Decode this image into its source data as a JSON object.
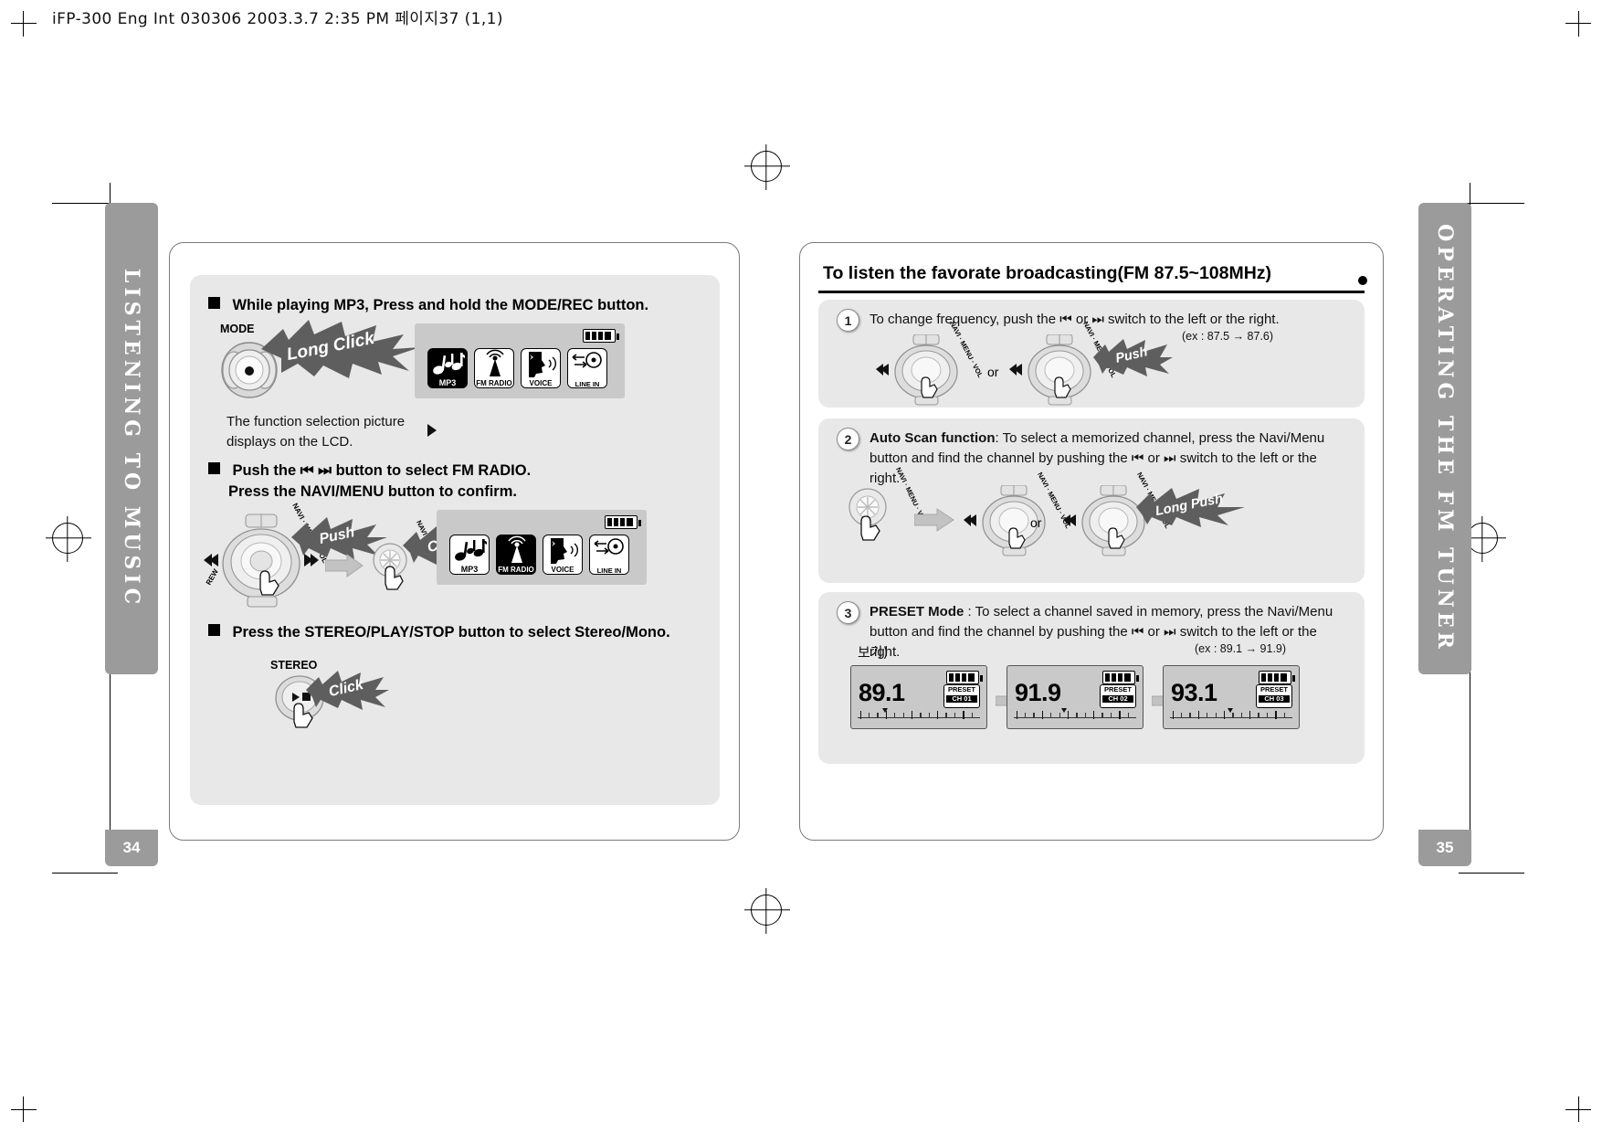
{
  "sheet": {
    "header_text": "iFP-300 Eng Int 030306  2003.3.7 2:35 PM 페이지37 (1,1)"
  },
  "colors": {
    "tab_grey": "#9b9b9b",
    "panel_grey": "#e8e8e8",
    "lcd_grey": "#c9c9c9",
    "page_border": "#7a7a7a",
    "ink": "#000000"
  },
  "left_page": {
    "tab_label": "LISTENING TO MUSIC",
    "page_number": "34",
    "steps": [
      {
        "heading": "While playing MP3, Press and hold the MODE/REC button.",
        "button_label": "MODE",
        "burst_label": "Long Click",
        "note": "The function selection picture displays on the LCD."
      },
      {
        "heading_line1": "Push the  ⏮  ⏭   button to select FM RADIO.",
        "heading_line2": "Press the NAVI/MENU button to confirm.",
        "burst_push": "Push",
        "burst_click": "Click"
      },
      {
        "heading": "Press the STEREO/PLAY/STOP button to select Stereo/Mono.",
        "button_label": "STEREO",
        "burst_label": "Click"
      }
    ],
    "lcd_top": {
      "icons": [
        {
          "name": "music-note-icon",
          "label": "MP3",
          "selected": true
        },
        {
          "name": "fm-antenna-icon",
          "label": "FM RADIO",
          "selected": false
        },
        {
          "name": "voice-face-icon",
          "label": "VOICE",
          "selected": false
        },
        {
          "name": "line-in-icon",
          "label": "LINE IN",
          "selected": false
        }
      ],
      "battery": "battery-full-icon"
    },
    "lcd_bottom": {
      "icons": [
        {
          "name": "music-note-icon",
          "label": "MP3",
          "selected": false
        },
        {
          "name": "fm-antenna-icon",
          "label": "FM RADIO",
          "selected": true
        },
        {
          "name": "voice-face-icon",
          "label": "VOICE",
          "selected": false
        },
        {
          "name": "line-in-icon",
          "label": "LINE IN",
          "selected": false
        }
      ],
      "battery": "battery-full-icon"
    },
    "jog_labels": {
      "navi_menu": "NAVI · MENU",
      "vol": "VOL",
      "rew": "REW"
    }
  },
  "right_page": {
    "tab_label": "OPERATING THE FM TUNER",
    "page_number": "35",
    "title": "To listen the favorate broadcasting(FM 87.5~108MHz)",
    "sections": [
      {
        "number": "1",
        "text": "To change frequency, push the  ⏮  or  ⏭   switch to the left or the right.",
        "example": "(ex : 87.5  → 87.6)",
        "or_label": "or",
        "burst_label": "Push"
      },
      {
        "number": "2",
        "bold_lead": "Auto Scan function",
        "text": ": To select a memorized channel, press the Navi/Menu button and find the channel by pushing the  ⏮  or  ⏭   switch to the left or the right.",
        "or_label": "or",
        "burst_label": "Long Push"
      },
      {
        "number": "3",
        "bold_lead": "PRESET Mode",
        "text": " : To select a channel saved in memory, press the Navi/Menu button and find the channel by pushing the  ⏮  or  ⏭   switch to the left or the right.",
        "example": "(ex : 89.1  → 91.9)",
        "korean_overlay": "보기)",
        "presets": [
          {
            "frequency": "89.1",
            "tag_top": "PRESET",
            "tag_bottom": "CH 01"
          },
          {
            "frequency": "91.9",
            "tag_top": "PRESET",
            "tag_bottom": "CH 02"
          },
          {
            "frequency": "93.1",
            "tag_top": "PRESET",
            "tag_bottom": "CH 03"
          }
        ]
      }
    ],
    "jog_labels": {
      "navi_menu": "NAVI · MENU",
      "vol": "VOL"
    }
  }
}
